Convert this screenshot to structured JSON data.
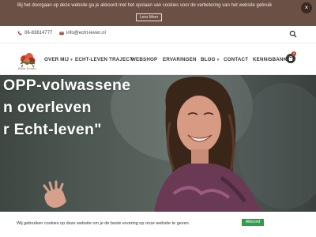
{
  "cookie_top": {
    "message": "Bij het doorgaan op deze website ga je akkoord met het opslaan van cookies voor de verbetering van het website gebruik",
    "button": "Lees Meer",
    "close": "×"
  },
  "contact": {
    "phone": "06-83614777",
    "email": "info@echt-leven.nl"
  },
  "brand": {
    "logo_text": "Echt Leven"
  },
  "nav": {
    "items": [
      {
        "label": "OVER MIJ",
        "dropdown": true
      },
      {
        "label": "ECHT-LEVEN TRAJECT",
        "dropdown": false
      },
      {
        "label": "WEBSHOP",
        "dropdown": false
      },
      {
        "label": "ERVARINGEN",
        "dropdown": false
      },
      {
        "label": "BLOG",
        "dropdown": true
      },
      {
        "label": "CONTACT",
        "dropdown": false
      },
      {
        "label": "KENNISBANK",
        "dropdown": false
      }
    ],
    "caret": "▾",
    "cart_count": "0"
  },
  "hero": {
    "line1": "OPP-volwassene",
    "line2": "n overleven",
    "line3": "r Echt-leven\""
  },
  "cookie_bottom": {
    "message": "Wij gebruiken cookies op deze website om je de beste ervaring op onze website te geven.",
    "button": "Akkoord"
  },
  "colors": {
    "top_banner": "#6a5045",
    "accept_green": "#2e9e48",
    "accent_red": "#c0392b"
  },
  "icons": [
    "phone-icon",
    "mail-icon",
    "search-icon",
    "cart-icon",
    "close-icon"
  ]
}
